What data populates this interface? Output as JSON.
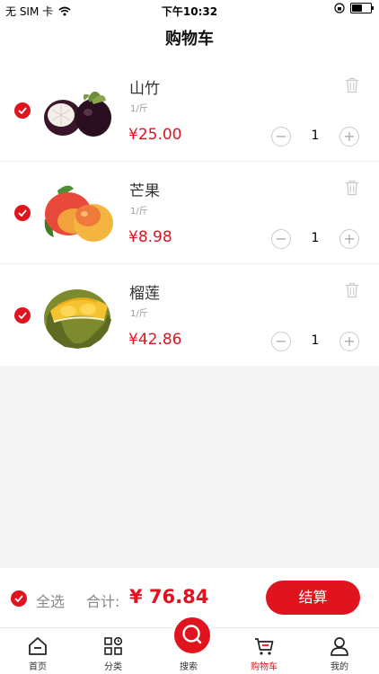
{
  "status_bar": {
    "carrier": "无 SIM 卡",
    "time": "下午10:32",
    "battery_level": 0.55
  },
  "nav": {
    "title": "购物车"
  },
  "items": [
    {
      "name": "山竹",
      "unit": "1/斤",
      "price": "¥25.00",
      "quantity": "1",
      "checked": true,
      "image": "mangosteen"
    },
    {
      "name": "芒果",
      "unit": "1/斤",
      "price": "¥8.98",
      "quantity": "1",
      "checked": true,
      "image": "mango"
    },
    {
      "name": "榴莲",
      "unit": "1/斤",
      "price": "¥42.86",
      "quantity": "1",
      "checked": true,
      "image": "durian"
    }
  ],
  "qty_controls": {
    "minus": "−",
    "plus": "+"
  },
  "summary": {
    "select_all_label": "全选",
    "total_label": "合计:",
    "total_value": "¥ 76.84",
    "checkout_label": "结算"
  },
  "tabs": [
    {
      "label": "首页",
      "icon": "home-icon",
      "active": false
    },
    {
      "label": "分类",
      "icon": "category-icon",
      "active": false
    },
    {
      "label": "搜索",
      "icon": "search-icon",
      "active": false
    },
    {
      "label": "购物车",
      "icon": "cart-icon",
      "active": true
    },
    {
      "label": "我的",
      "icon": "profile-icon",
      "active": false
    }
  ],
  "colors": {
    "accent": "#e0141e",
    "background": "#f4f4f4",
    "muted": "#999999"
  }
}
